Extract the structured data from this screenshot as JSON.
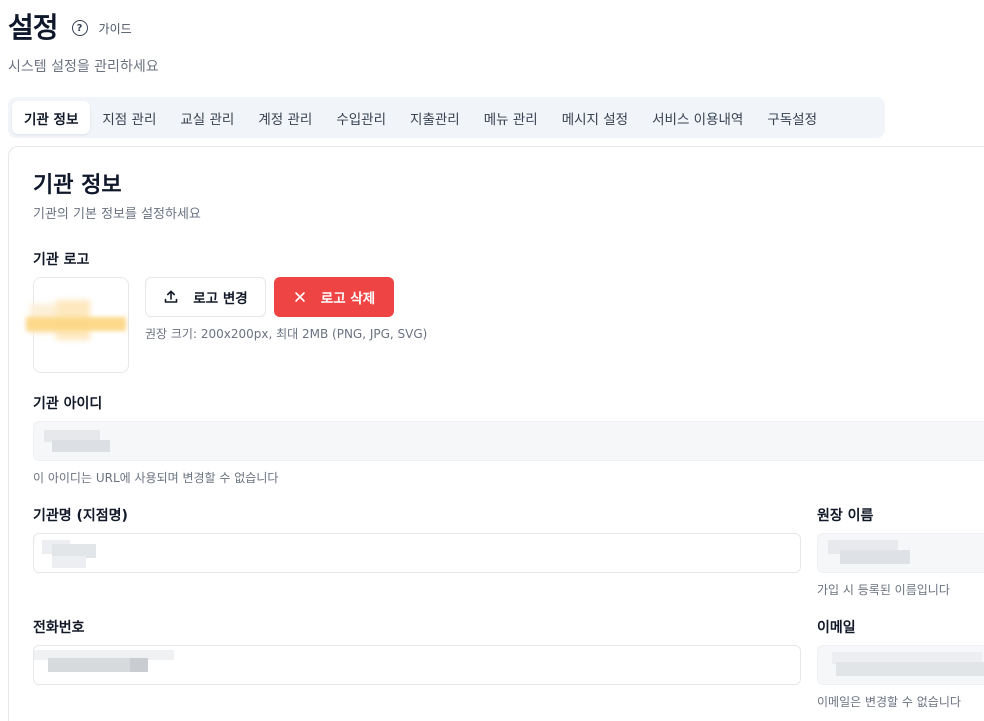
{
  "header": {
    "title": "설정",
    "guide_icon": "help-circle-icon",
    "guide_label": "가이드",
    "subtitle": "시스템 설정을 관리하세요"
  },
  "tabs": [
    {
      "label": "기관 정보",
      "active": true
    },
    {
      "label": "지점 관리",
      "active": false
    },
    {
      "label": "교실 관리",
      "active": false
    },
    {
      "label": "계정 관리",
      "active": false
    },
    {
      "label": "수입관리",
      "active": false
    },
    {
      "label": "지출관리",
      "active": false
    },
    {
      "label": "메뉴 관리",
      "active": false
    },
    {
      "label": "메시지 설정",
      "active": false
    },
    {
      "label": "서비스 이용내역",
      "active": false
    },
    {
      "label": "구독설정",
      "active": false
    }
  ],
  "section": {
    "title": "기관 정보",
    "description": "기관의 기본 정보를 설정하세요"
  },
  "logo": {
    "label": "기관 로고",
    "change_button": "로고 변경",
    "change_icon": "upload-icon",
    "delete_button": "로고 삭제",
    "delete_icon": "close-icon",
    "hint": "권장 크기: 200x200px, 최대 2MB (PNG, JPG, SVG)"
  },
  "fields": {
    "org_id": {
      "label": "기관 아이디",
      "hint": "이 아이디는 URL에 사용되며 변경할 수 없습니다"
    },
    "org_name": {
      "label": "기관명 (지점명)"
    },
    "director": {
      "label": "원장 이름",
      "hint": "가입 시 등록된 이름입니다"
    },
    "phone": {
      "label": "전화번호"
    },
    "email": {
      "label": "이메일",
      "hint": "이메일은 변경할 수 없습니다"
    }
  },
  "colors": {
    "danger": "#ef4444",
    "tab_bg": "#f1f4f8",
    "muted_text": "#6b7280"
  }
}
